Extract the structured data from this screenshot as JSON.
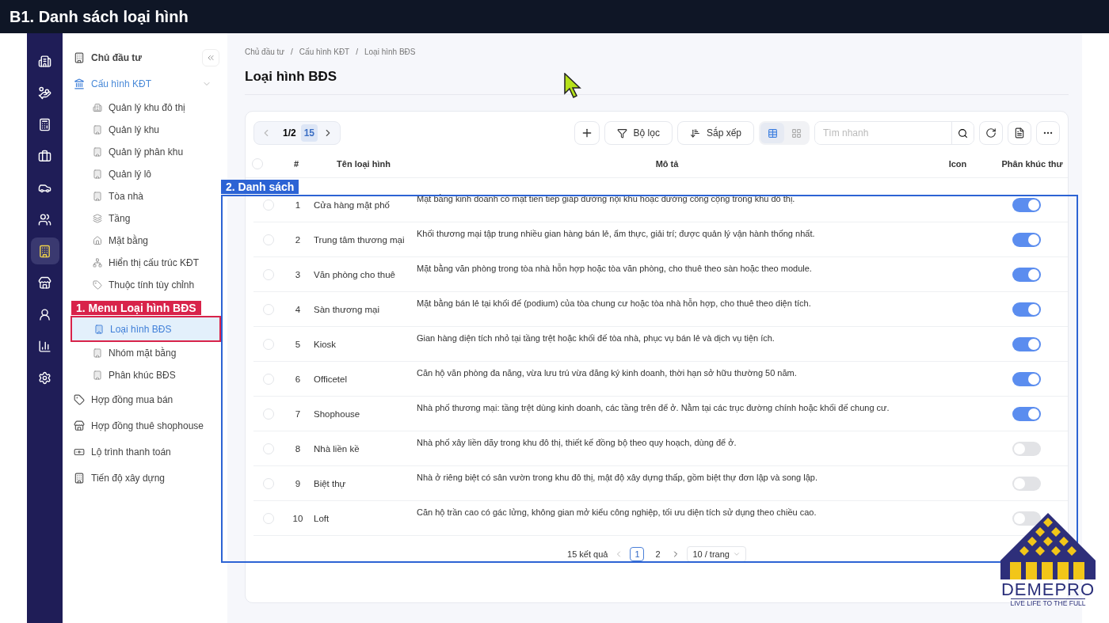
{
  "banner": {
    "title": "B1. Danh sách loại hình"
  },
  "rail": [
    {
      "kind": "building",
      "selected": false
    },
    {
      "kind": "investor",
      "selected": false
    },
    {
      "kind": "calculator",
      "selected": false
    },
    {
      "kind": "briefcase",
      "selected": false
    },
    {
      "kind": "car",
      "selected": false
    },
    {
      "kind": "users",
      "selected": false
    },
    {
      "kind": "office",
      "selected": true
    },
    {
      "kind": "store",
      "selected": false
    },
    {
      "kind": "user",
      "selected": false
    },
    {
      "kind": "chart",
      "selected": false
    },
    {
      "kind": "settings",
      "selected": false
    }
  ],
  "sidebar": {
    "items": [
      {
        "label": "Chủ đầu tư",
        "kind": "office",
        "selected": false,
        "bold": true
      },
      {
        "label": "Cấu hình KĐT",
        "kind": "bank",
        "selected": false,
        "expanded": true,
        "children": [
          {
            "label": "Quản lý khu đô thị",
            "kind": "buildings",
            "selected": false
          },
          {
            "label": "Quản lý khu",
            "kind": "office",
            "selected": false
          },
          {
            "label": "Quản lý phân khu",
            "kind": "office",
            "selected": false
          },
          {
            "label": "Quản lý lô",
            "kind": "office",
            "selected": false
          },
          {
            "label": "Tòa nhà",
            "kind": "tower",
            "selected": false
          },
          {
            "label": "Tầng",
            "kind": "layers",
            "selected": false
          },
          {
            "label": "Mặt bằng",
            "kind": "home",
            "selected": false
          },
          {
            "label": "Hiển thị cấu trúc KĐT",
            "kind": "tree",
            "selected": false
          },
          {
            "label": "Thuộc tính tùy chỉnh",
            "kind": "tag",
            "selected": false
          },
          {
            "label": "Loại hình BĐS",
            "kind": "tower",
            "selected": true
          },
          {
            "label": "Nhóm mặt bằng",
            "kind": "tower",
            "selected": false
          },
          {
            "label": "Phân khúc BĐS",
            "kind": "tower",
            "selected": false
          }
        ]
      },
      {
        "label": "Hợp đồng mua bán",
        "kind": "tag",
        "selected": false
      },
      {
        "label": "Hợp đồng thuê shophouse",
        "kind": "store",
        "selected": false
      },
      {
        "label": "Lộ trình thanh toán",
        "kind": "money",
        "selected": false
      },
      {
        "label": "Tiến độ xây dựng",
        "kind": "tower",
        "selected": false
      }
    ]
  },
  "breadcrumb": {
    "separator": "/",
    "items": [
      "Chủ đầu tư",
      "Cấu hình KĐT",
      "Loại hình BĐS"
    ]
  },
  "page_title": "Loại hình BĐS",
  "toolbar": {
    "page": "1/2",
    "count": "15",
    "filter": "Bộ lọc",
    "sort": "Sắp xếp",
    "views": [
      {
        "kind": "table",
        "selected": true
      },
      {
        "kind": "grid",
        "selected": false
      }
    ],
    "search_placeholder": "Tìm nhanh"
  },
  "table": {
    "select_all": {
      "checked": false
    },
    "columns": [
      "#",
      "Tên loại hình",
      "Mô tả",
      "Icon",
      "Phân khúc thư"
    ],
    "rows": [
      {
        "index": "1",
        "checked": false,
        "name": "Cửa hàng mặt phố",
        "description": "Mặt bằng kinh doanh có mặt tiền tiếp giáp đường nội khu hoặc đường công cộng trong khu đô thị.",
        "on": true
      },
      {
        "index": "2",
        "checked": false,
        "name": "Trung tâm thương mại",
        "description": "Khối thương mại tập trung nhiều gian hàng bán lẻ, ẩm thực, giải trí; được quản lý vận hành thống nhất.",
        "on": true
      },
      {
        "index": "3",
        "checked": false,
        "name": "Văn phòng cho thuê",
        "description": "Mặt bằng văn phòng trong tòa nhà hỗn hợp hoặc tòa văn phòng, cho thuê theo sàn hoặc theo module.",
        "on": true
      },
      {
        "index": "4",
        "checked": false,
        "name": "Sàn thương mại",
        "description": "Mặt bằng bán lẻ tại khối đế (podium) của tòa chung cư hoặc tòa nhà hỗn hợp, cho thuê theo diện tích.",
        "on": true
      },
      {
        "index": "5",
        "checked": false,
        "name": "Kiosk",
        "description": "Gian hàng diện tích nhỏ tại tầng trệt hoặc khối đế tòa nhà, phục vụ bán lẻ và dịch vụ tiện ích.",
        "on": true
      },
      {
        "index": "6",
        "checked": false,
        "name": "Officetel",
        "description": "Căn hộ văn phòng đa năng, vừa lưu trú vừa đăng ký kinh doanh, thời hạn sở hữu thường 50 năm.",
        "on": true
      },
      {
        "index": "7",
        "checked": false,
        "name": "Shophouse",
        "description": "Nhà phố thương mại: tầng trệt dùng kinh doanh, các tầng trên để ở. Nằm tại các trục đường chính hoặc khối đế chung cư.",
        "on": true
      },
      {
        "index": "8",
        "checked": false,
        "name": "Nhà liền kề",
        "description": "Nhà phố xây liền dãy trong khu đô thị, thiết kế đồng bộ theo quy hoạch, dùng để ở.",
        "on": false
      },
      {
        "index": "9",
        "checked": false,
        "name": "Biệt thự",
        "description": "Nhà ở riêng biệt có sân vườn trong khu đô thị, mật độ xây dựng thấp, gồm biệt thự đơn lập và song lập.",
        "on": false
      },
      {
        "index": "10",
        "checked": false,
        "name": "Loft",
        "description": "Căn hộ trần cao có gác lửng, không gian mở kiểu công nghiệp, tối ưu diện tích sử dụng theo chiều cao.",
        "on": false
      }
    ]
  },
  "pagination": {
    "total": "15 kết quả",
    "pages": [
      {
        "label": "1",
        "selected": true
      },
      {
        "label": "2",
        "selected": false
      }
    ],
    "page_size": "10 / trang"
  },
  "annotations": [
    {
      "kind": "menu",
      "label": "1. Menu Loại hình BĐS"
    },
    {
      "kind": "list",
      "label": "2. Danh sách"
    }
  ],
  "logo": {
    "name": "DEMEPRO",
    "tagline": "LIVE LIFE TO THE FULL"
  }
}
